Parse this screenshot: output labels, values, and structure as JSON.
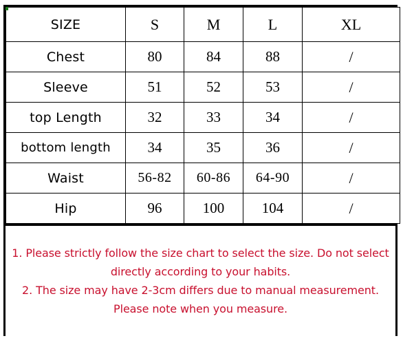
{
  "table": {
    "columns": [
      "SIZE",
      "S",
      "M",
      "L",
      "XL"
    ],
    "rows": [
      {
        "label": "Chest",
        "values": [
          "80",
          "84",
          "88",
          "/"
        ]
      },
      {
        "label": "Sleeve",
        "values": [
          "51",
          "52",
          "53",
          "/"
        ]
      },
      {
        "label": "top Length",
        "values": [
          "32",
          "33",
          "34",
          "/"
        ]
      },
      {
        "label": "bottom length",
        "values": [
          "34",
          "35",
          "36",
          "/"
        ]
      },
      {
        "label": "Waist",
        "values": [
          "56-82",
          "60-86",
          "64-90",
          "/"
        ]
      },
      {
        "label": "Hip",
        "values": [
          "96",
          "100",
          "104",
          "/"
        ]
      }
    ]
  },
  "notes": {
    "lines": [
      "1. Please strictly follow the size chart  to select the size. Do not select",
      "directly according to your habits.",
      "2. The size may have 2-3cm differs due to manual measurement.",
      "Please note when you measure."
    ],
    "color": "#c8102e"
  }
}
